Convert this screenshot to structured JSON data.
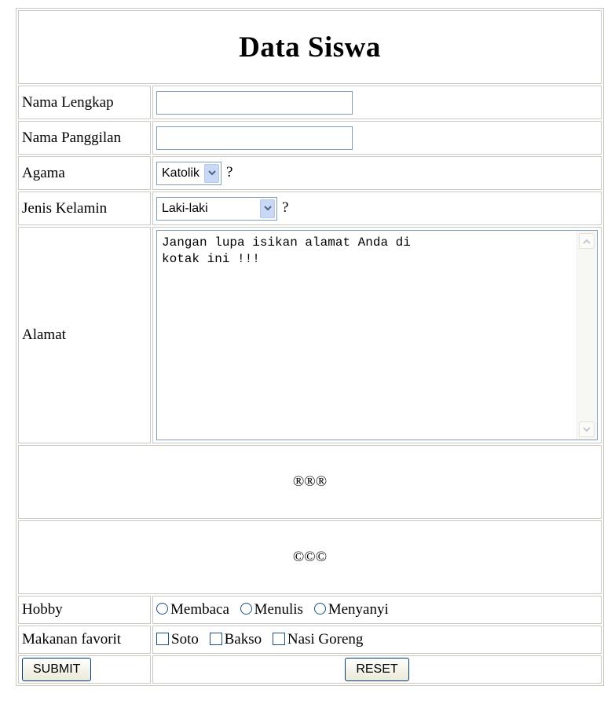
{
  "form": {
    "title": "Data Siswa",
    "fields": {
      "nama_lengkap": {
        "label": "Nama Lengkap",
        "value": ""
      },
      "nama_panggilan": {
        "label": "Nama Panggilan",
        "value": ""
      },
      "agama": {
        "label": "Agama",
        "selected": "Katolik",
        "suffix": "?"
      },
      "jenis_kelamin": {
        "label": "Jenis Kelamin",
        "selected": "Laki-laki",
        "suffix": "?"
      },
      "alamat": {
        "label": "Alamat",
        "value": "Jangan lupa isikan alamat Anda di\nkotak ini !!!"
      }
    },
    "symbols_registered": "®®®",
    "symbols_copyright": "©©©",
    "hobby": {
      "label": "Hobby",
      "options": [
        "Membaca",
        "Menulis",
        "Menyanyi"
      ]
    },
    "makanan": {
      "label": "Makanan favorit",
      "options": [
        "Soto",
        "Bakso",
        "Nasi Goreng"
      ]
    },
    "buttons": {
      "submit": "SUBMIT",
      "reset": "RESET"
    }
  },
  "icons": {
    "dropdown_arrow": "chevron-down-icon",
    "scroll_up": "arrow-up-icon",
    "scroll_down": "arrow-down-icon"
  },
  "colors": {
    "border": "#c9c9c1",
    "input_border": "#7f9db9",
    "button_border": "#003c74",
    "dropdown_arrow_bg": "#c9d8f5"
  }
}
